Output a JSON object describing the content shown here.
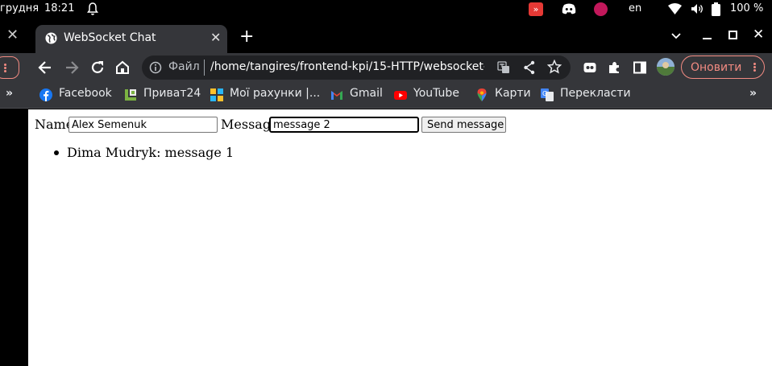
{
  "system_bar": {
    "date": "грудня",
    "time": "18:21",
    "language": "en",
    "battery": "100 %"
  },
  "browser": {
    "inactive_tab_close": "✕",
    "tab": {
      "title": "WebSocket Chat",
      "close": "✕"
    },
    "new_tab": "+",
    "window": {
      "close": "✕"
    },
    "address_bar": {
      "scheme_label": "Файл",
      "url": "/home/tangires/frontend-kpi/15-HTTP/websocket-cl..."
    },
    "update_button": "Оновити",
    "bookmarks_overflow_left": "»",
    "bookmarks_overflow_right": "»",
    "bookmarks": [
      {
        "label": "Facebook",
        "icon": "facebook-icon"
      },
      {
        "label": "Приват24",
        "icon": "privat24-icon"
      },
      {
        "label": "Мої рахунки |...",
        "icon": "accounts-icon"
      },
      {
        "label": "Gmail",
        "icon": "gmail-icon"
      },
      {
        "label": "YouTube",
        "icon": "youtube-icon"
      },
      {
        "label": "Карти",
        "icon": "maps-icon"
      },
      {
        "label": "Перекласти",
        "icon": "translate-icon"
      }
    ]
  },
  "chat": {
    "name_label": "Name",
    "name_value": "Alex Semenuk",
    "message_label": "Message",
    "message_value": "message 2",
    "send_label": "Send message",
    "messages": [
      {
        "author": "Dima Mudryk",
        "text": "message 1"
      }
    ]
  },
  "colors": {
    "chrome_dark": "#35363a",
    "omnibox": "#202124",
    "update_accent": "#f28b82"
  }
}
